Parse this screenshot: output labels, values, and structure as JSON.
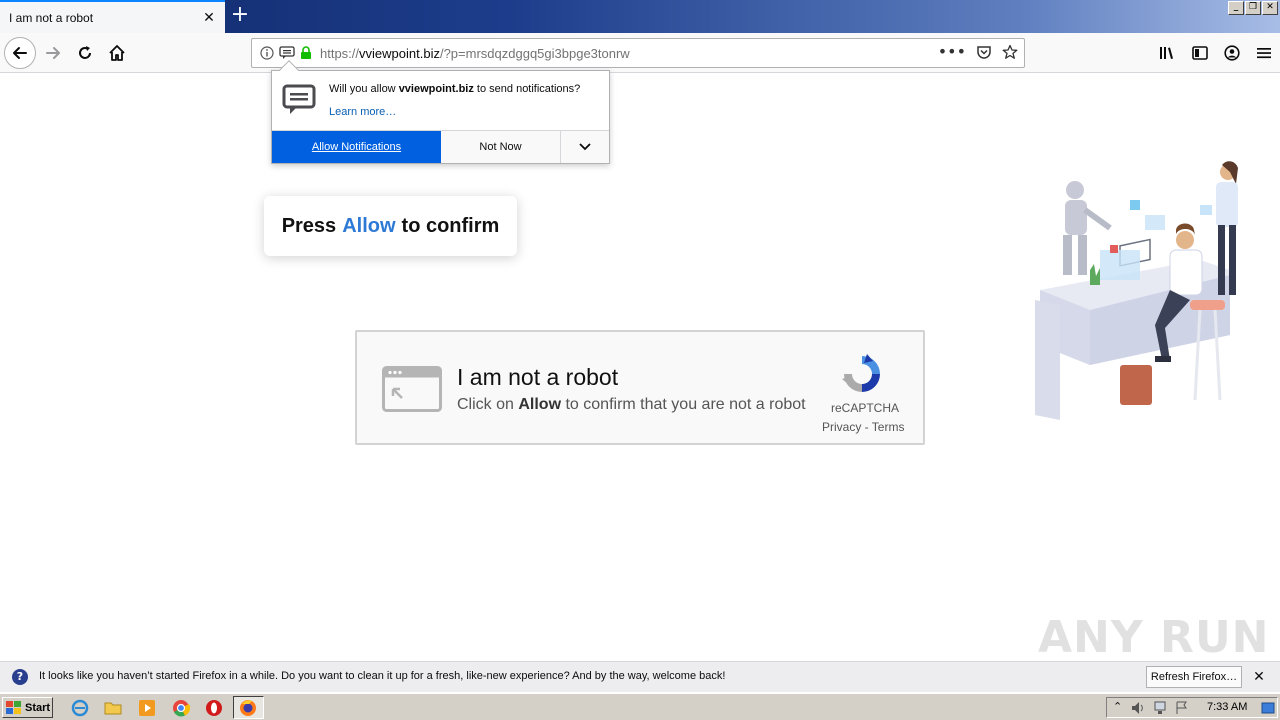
{
  "browser": {
    "tab_title": "I am not a robot",
    "url_prefix": "https://",
    "url_host": "vviewpoint.biz",
    "url_path": "/?p=mrsdqzdggq5gi3bpge3tonrw"
  },
  "doorhanger": {
    "message_prefix": "Will you allow ",
    "message_host": "vviewpoint.biz",
    "message_suffix": " to send notifications?",
    "learn_more": "Learn more…",
    "allow_label": "Allow Notifications",
    "not_now_label": "Not Now"
  },
  "page": {
    "press_prefix": "Press",
    "press_highlight": "Allow",
    "press_suffix": "to confirm",
    "captcha_title": "I am not a robot",
    "captcha_sub_prefix": "Click on ",
    "captcha_sub_bold": "Allow",
    "captcha_sub_suffix": " to confirm that you are not a robot",
    "recaptcha_label": "reCAPTCHA",
    "recaptcha_links": "Privacy - Terms"
  },
  "watermark": "ANY RUN",
  "infobar": {
    "message": "It looks like you haven’t started Firefox in a while. Do you want to clean it up for a fresh, like-new experience? And by the way, welcome back!",
    "button_label": "Refresh Firefox…"
  },
  "taskbar": {
    "start_label": "Start",
    "clock": "7:33 AM"
  },
  "colors": {
    "accent_blue": "#0060df",
    "highlight_text": "#2d7ad6"
  }
}
